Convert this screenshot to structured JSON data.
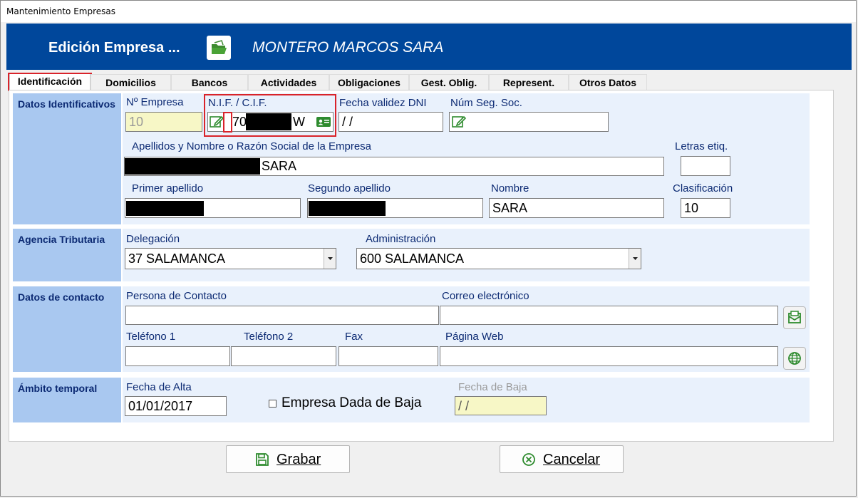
{
  "window": {
    "title": "Mantenimiento Empresas"
  },
  "header": {
    "title": "Edición Empresa ...",
    "company_name": "MONTERO MARCOS SARA",
    "folder_icon": "folder-open-icon"
  },
  "tabs": [
    {
      "label": "Identificación",
      "active": true
    },
    {
      "label": "Domicilios"
    },
    {
      "label": "Bancos"
    },
    {
      "label": "Actividades"
    },
    {
      "label": "Obligaciones"
    },
    {
      "label": "Gest. Oblig."
    },
    {
      "label": "Represent."
    },
    {
      "label": "Otros Datos"
    }
  ],
  "identificativos": {
    "section_label": "Datos Identificativos",
    "num_empresa_label": "Nº Empresa",
    "num_empresa_value": "10",
    "nif_label": "N.I.F. / C.I.F.",
    "nif_prefix": "70",
    "nif_suffix": "W",
    "fecha_dni_label": "Fecha validez DNI",
    "fecha_dni_value": " /  /",
    "seg_soc_label": "Núm Seg. Soc.",
    "razon_social_label": "Apellidos y Nombre o Razón Social de la Empresa",
    "razon_social_value": "SARA",
    "letras_label": "Letras etiq.",
    "letras_value": "",
    "primer_apellido_label": "Primer apellido",
    "segundo_apellido_label": "Segundo apellido",
    "nombre_label": "Nombre",
    "nombre_value": "SARA",
    "clasificacion_label": "Clasificación",
    "clasificacion_value": "10"
  },
  "agencia": {
    "section_label": "Agencia Tributaria",
    "delegacion_label": "Delegación",
    "delegacion_value": "37  SALAMANCA",
    "administracion_label": "Administración",
    "administracion_value": "600  SALAMANCA"
  },
  "contacto": {
    "section_label": "Datos de contacto",
    "persona_label": "Persona de Contacto",
    "persona_value": "",
    "correo_label": "Correo electrónico",
    "correo_value": "",
    "telefono1_label": "Teléfono 1",
    "telefono2_label": "Teléfono 2",
    "fax_label": "Fax",
    "web_label": "Página Web"
  },
  "temporal": {
    "section_label": "Ámbito temporal",
    "alta_label": "Fecha de Alta",
    "alta_value": "01/01/2017",
    "baja_checkbox_label": "Empresa Dada de Baja",
    "baja_checked": false,
    "fecha_baja_label": "Fecha de Baja",
    "fecha_baja_value": " /  /"
  },
  "buttons": {
    "grabar_label": "Grabar",
    "cancelar_label": "Cancelar"
  },
  "colors": {
    "header": "#00479b",
    "section_label_bg": "#a9c8f0",
    "section_body_bg": "#e9f1fc",
    "label_text": "#0c2a73",
    "highlight": "#d9232a",
    "icon_green": "#2e8b2e"
  }
}
